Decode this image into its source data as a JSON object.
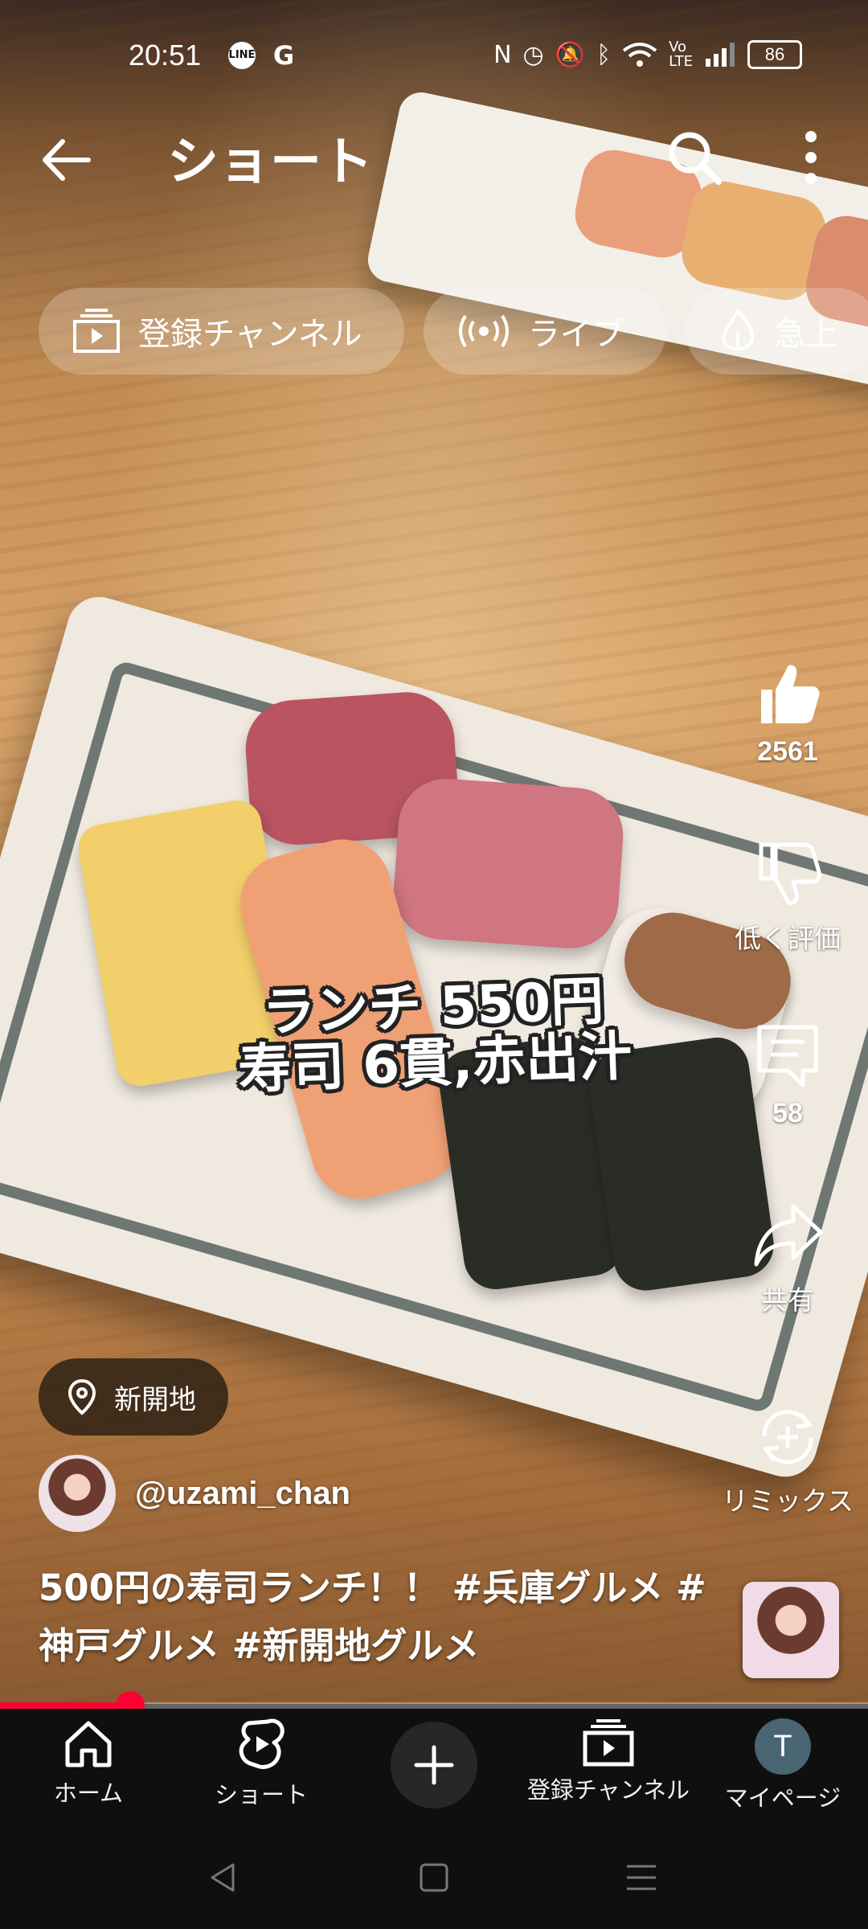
{
  "status_bar": {
    "time": "20:51",
    "app_icons": [
      "LINE",
      "G"
    ],
    "battery": "86"
  },
  "header": {
    "title": "ショート",
    "icons": [
      "back-arrow-icon",
      "search-icon",
      "more-vert-icon"
    ]
  },
  "chips": [
    {
      "label": "登録チャンネル",
      "icon": "subscriptions-icon"
    },
    {
      "label": "ライブ",
      "icon": "live-icon"
    },
    {
      "label": "急上",
      "icon": "trending-icon"
    }
  ],
  "video": {
    "caption_line1": "ランチ 550円",
    "caption_line2": "寿司 6貫,赤出汁"
  },
  "actions": {
    "like_count": "2561",
    "dislike_label": "低く評価",
    "comment_count": "58",
    "share_label": "共有",
    "remix_label": "リミックス"
  },
  "location": {
    "label": "新開地"
  },
  "channel": {
    "handle": "@uzami_chan"
  },
  "description": {
    "text": "500円の寿司ランチ！！",
    "tag1": "#兵庫グルメ",
    "tag1_suffix": "#",
    "tag2": "神戸グルメ",
    "tag3": "#新開地グルメ"
  },
  "progress": {
    "fraction": 0.15
  },
  "nav": {
    "home": "ホーム",
    "shorts": "ショート",
    "subscriptions": "登録チャンネル",
    "mypage": "マイページ",
    "avatar_letter": "T"
  },
  "colors": {
    "accent": "#ff0033",
    "nav_background": "#0f0f0f"
  }
}
